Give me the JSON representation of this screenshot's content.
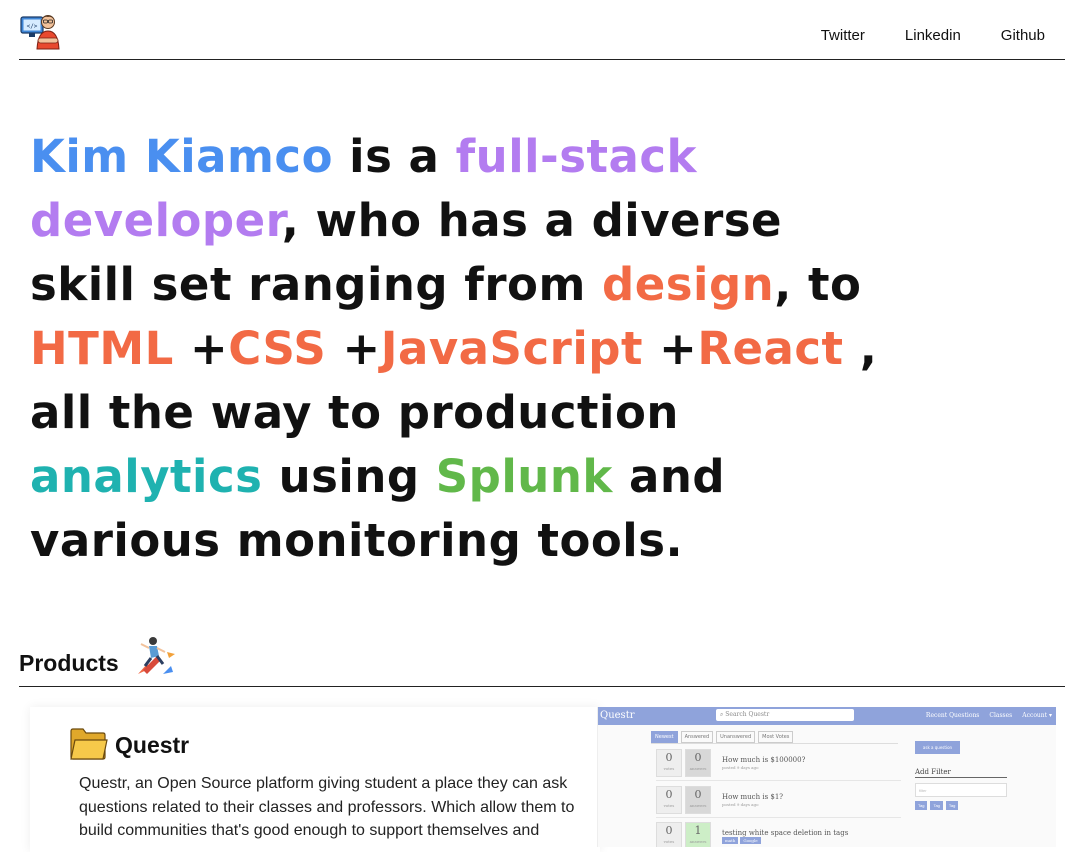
{
  "header": {
    "logo_icon": "developer-avatar-icon",
    "nav": [
      "Twitter",
      "Linkedin",
      "Github"
    ]
  },
  "hero": {
    "segments": {
      "name": "Kim Kiamco",
      "is_a": " is a ",
      "full_stack": "full-stack",
      "developer": "developer",
      "who_has": ", who has a diverse",
      "skill_set": "skill set ranging from ",
      "design": "design",
      "to": ", to",
      "html": "HTML",
      "plus1": " +",
      "css": "CSS",
      "plus2": " +",
      "javascript": "JavaScript",
      "plus3": " +",
      "react": "React",
      "comma": " ,",
      "production": "all the way to production",
      "analytics": "analytics",
      "using": " using ",
      "splunk": "Splunk",
      "and": " and",
      "various": "various monitoring tools."
    },
    "colors": {
      "name": "#4a8ff0",
      "role": "#b37cf0",
      "skills": "#f26a45",
      "analytics": "#1fb2b0",
      "splunk": "#61b84a"
    }
  },
  "products": {
    "title": "Products",
    "icon": "rocket-person-icon"
  },
  "card": {
    "icon": "folder-icon",
    "title": "Questr",
    "description": "Questr, an Open Source platform giving student a place they can ask questions related to their classes and professors. Which allow them to build communities that's good enough to support themselves and"
  },
  "preview": {
    "brand": "Questr",
    "search_placeholder": "Search Questr",
    "menu": [
      "Recent Questions",
      "Classes",
      "Account ▾"
    ],
    "tabs": [
      "Newest",
      "Answered",
      "Unanswered",
      "Most Votes"
    ],
    "ask_button": "ask a question",
    "filter_title": "Add Filter",
    "filter_placeholder": "filter",
    "filter_tags": [
      "Tag",
      "Tag",
      "Tag"
    ],
    "votes_label": "votes",
    "answers_label": "answers",
    "questions": [
      {
        "votes": "0",
        "answers": "0",
        "title": "How much is $100000?",
        "meta": "posted 9 days ago",
        "tags": []
      },
      {
        "votes": "0",
        "answers": "0",
        "title": "How much is $1?",
        "meta": "posted 9 days ago",
        "tags": []
      },
      {
        "votes": "0",
        "answers": "1",
        "title": "testing white space deletion in tags",
        "meta": "",
        "tags": [
          "math",
          "Google"
        ]
      }
    ]
  }
}
